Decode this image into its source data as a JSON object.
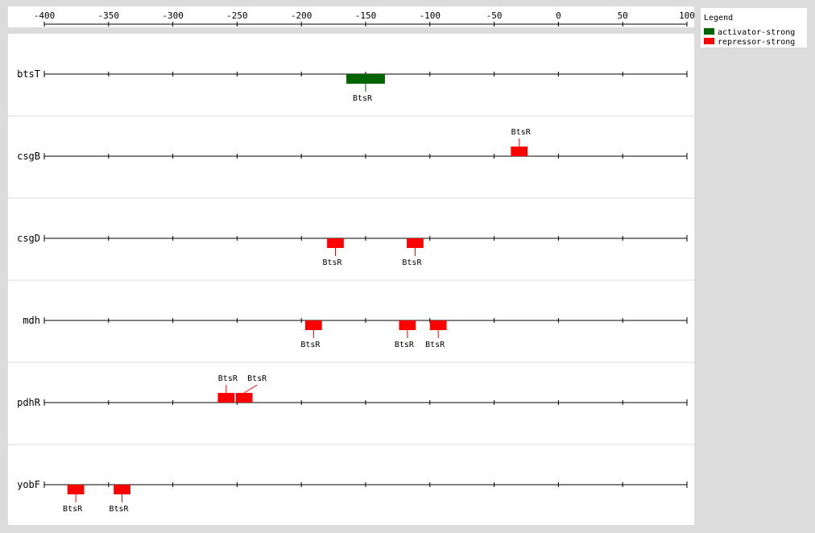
{
  "axis": {
    "min": -400,
    "max": 100,
    "ticks": [
      "-400",
      "-350",
      "-300",
      "-250",
      "-200",
      "-150",
      "-100",
      "-50",
      "0",
      "50",
      "100"
    ]
  },
  "legend": {
    "title": "Legend",
    "items": [
      {
        "label": "activator-strong",
        "color": "#006400"
      },
      {
        "label": "repressor-strong",
        "color": "#ff0000"
      }
    ]
  },
  "colors": {
    "activator-strong": "#006400",
    "repressor-strong": "#ff0000",
    "panel": "#ffffff",
    "background": "#dcdcdc",
    "separator": "#dcdcdc"
  },
  "genes": [
    {
      "name": "btsT",
      "sites": [
        {
          "label": "BtsR",
          "start": -165,
          "end": -135,
          "type": "activator-strong",
          "label_pos": "below"
        }
      ]
    },
    {
      "name": "csgB",
      "sites": [
        {
          "label": "BtsR",
          "start": -37,
          "end": -24,
          "type": "repressor-strong",
          "label_pos": "above"
        }
      ]
    },
    {
      "name": "csgD",
      "sites": [
        {
          "label": "BtsR",
          "start": -180,
          "end": -167,
          "type": "repressor-strong",
          "label_pos": "below"
        },
        {
          "label": "BtsR",
          "start": -118,
          "end": -105,
          "type": "repressor-strong",
          "label_pos": "below"
        }
      ]
    },
    {
      "name": "mdh",
      "sites": [
        {
          "label": "BtsR",
          "start": -197,
          "end": -184,
          "type": "repressor-strong",
          "label_pos": "below"
        },
        {
          "label": "BtsR",
          "start": -124,
          "end": -111,
          "type": "repressor-strong",
          "label_pos": "below"
        },
        {
          "label": "BtsR",
          "start": -100,
          "end": -87,
          "type": "repressor-strong",
          "label_pos": "below"
        }
      ]
    },
    {
      "name": "pdhR",
      "sites": [
        {
          "label": "BtsR",
          "start": -265,
          "end": -252,
          "type": "repressor-strong",
          "label_pos": "above"
        },
        {
          "label": "BtsR",
          "start": -251,
          "end": -238,
          "type": "repressor-strong",
          "label_pos": "above-right"
        }
      ]
    },
    {
      "name": "yobF",
      "sites": [
        {
          "label": "BtsR",
          "start": -382,
          "end": -369,
          "type": "repressor-strong",
          "label_pos": "below"
        },
        {
          "label": "BtsR",
          "start": -346,
          "end": -333,
          "type": "repressor-strong",
          "label_pos": "below"
        }
      ]
    }
  ]
}
